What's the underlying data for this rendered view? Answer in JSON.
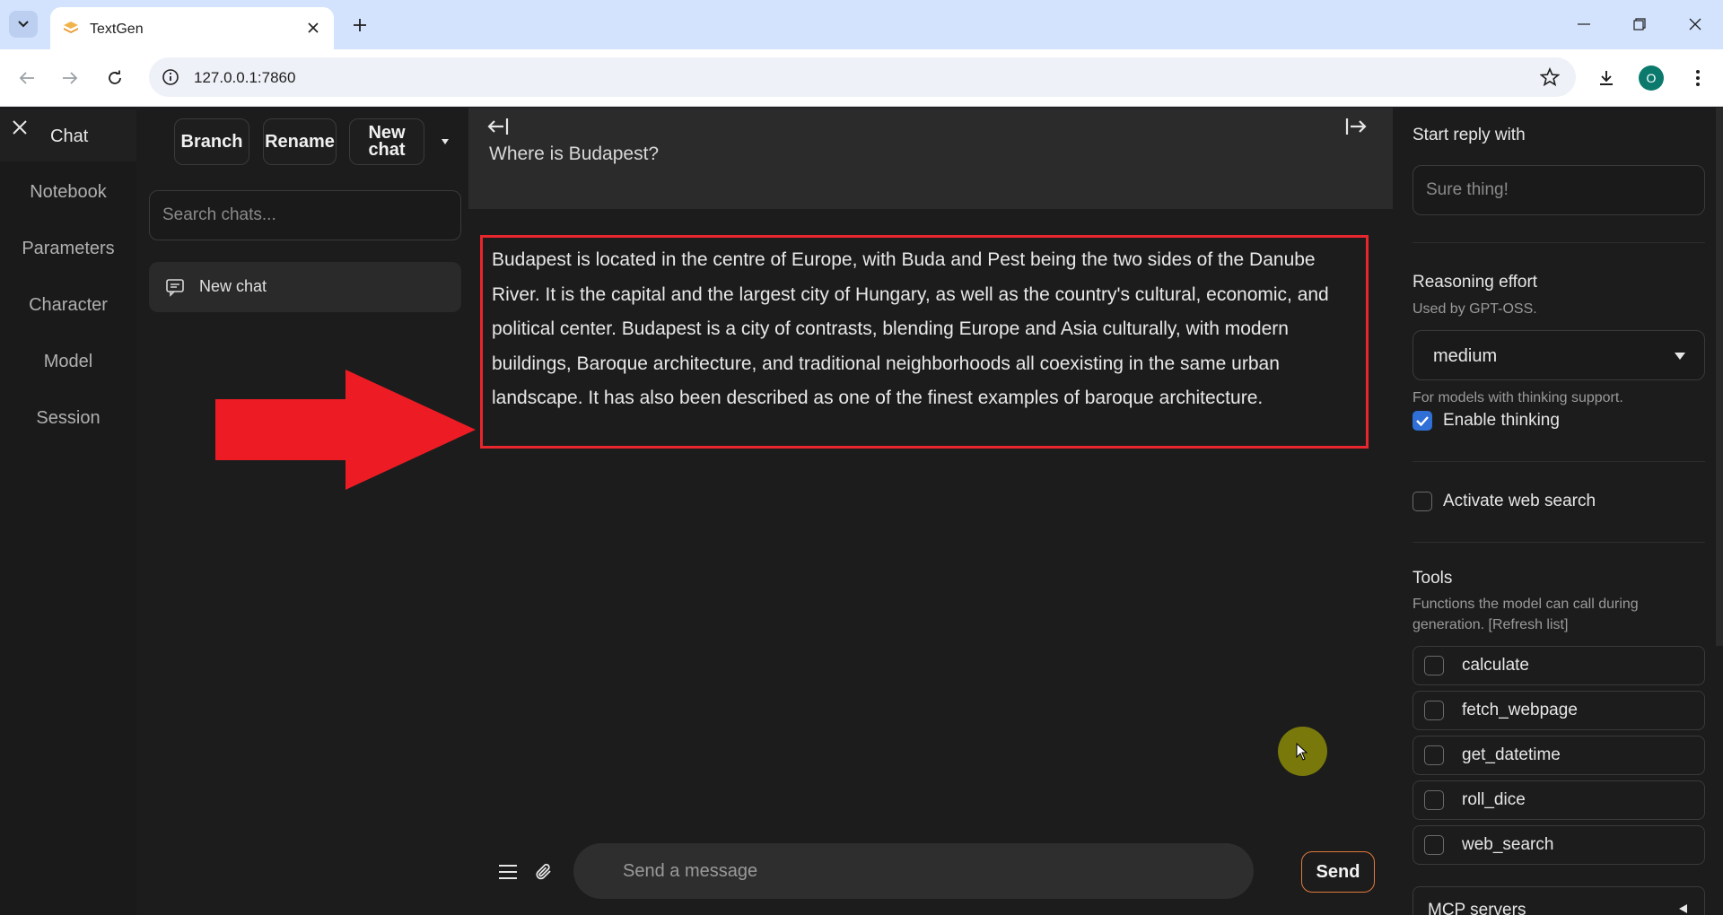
{
  "browser": {
    "tab_title": "TextGen",
    "url": "127.0.0.1:7860",
    "profile_initial": "O"
  },
  "left_nav": {
    "items": [
      {
        "label": "Chat",
        "active": true
      },
      {
        "label": "Notebook"
      },
      {
        "label": "Parameters"
      },
      {
        "label": "Character"
      },
      {
        "label": "Model"
      },
      {
        "label": "Session"
      }
    ]
  },
  "chat_panel": {
    "branch_label": "Branch",
    "rename_label": "Rename",
    "new_chat_label": "New chat",
    "search_placeholder": "Search chats...",
    "chats": [
      {
        "label": "New chat"
      }
    ]
  },
  "conversation": {
    "user_message": "Where is Budapest?",
    "assistant_message": "Budapest is located in the centre of Europe, with Buda and Pest being the two sides of the Danube River. It is the capital and the largest city of Hungary, as well as the country's cultural, economic, and political center. Budapest is a city of contrasts, blending Europe and Asia culturally, with modern buildings, Baroque architecture, and traditional neighborhoods all coexisting in the same urban landscape. It has also been described as one of the finest examples of baroque architecture."
  },
  "composer": {
    "placeholder": "Send a message",
    "send_label": "Send"
  },
  "settings": {
    "start_reply_label": "Start reply with",
    "start_reply_placeholder": "Sure thing!",
    "reasoning_label": "Reasoning effort",
    "reasoning_sub": "Used by GPT-OSS.",
    "reasoning_value": "medium",
    "thinking_sub": "For models with thinking support.",
    "enable_thinking_label": "Enable thinking",
    "enable_thinking_checked": true,
    "web_search_label": "Activate web search",
    "web_search_checked": false,
    "tools_label": "Tools",
    "tools_sub": "Functions the model can call during generation. [Refresh list]",
    "tools": [
      {
        "label": "calculate",
        "checked": false
      },
      {
        "label": "fetch_webpage",
        "checked": false
      },
      {
        "label": "get_datetime",
        "checked": false
      },
      {
        "label": "roll_dice",
        "checked": false
      },
      {
        "label": "web_search",
        "checked": false
      }
    ],
    "mcp_label": "MCP servers"
  },
  "colors": {
    "highlight_border": "#e8262d",
    "send_border": "#e07a3c",
    "checkbox_checked": "#2f6fd6",
    "cursor_highlight": "#8a8a08"
  }
}
